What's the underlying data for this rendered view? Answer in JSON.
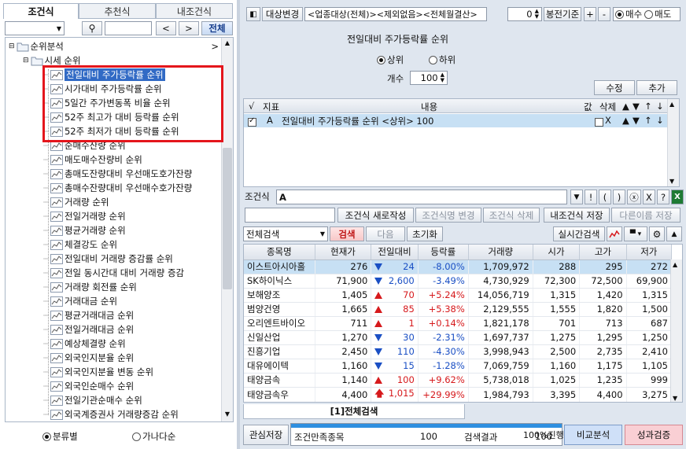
{
  "left": {
    "tabs": [
      "조건식",
      "추천식",
      "내조건식"
    ],
    "search_button": "전체",
    "tree": {
      "root": "순위분석",
      "group": "시세 순위",
      "items": [
        "전일대비 주가등락률 순위",
        "시가대비 주가등락률  순위",
        "5일간 주가변동폭 비율 순위",
        "52주 최고가 대비 등락률 순위",
        "52주 최저가 대비 등락률 순위",
        "순매수잔량 순위",
        "매도매수잔량비 순위",
        "총매도잔량대비 우선매도호가잔량",
        "총매수잔량대비 우선매수호가잔량",
        "거래량 순위",
        "전일거래량 순위",
        "평균거래량 순위",
        "체결강도 순위",
        "전일대비 거래량 증감률 순위",
        "전일 동시간대 대비 거래량 증감",
        "거래량 회전률 순위",
        "거래대금 순위",
        "평균거래대금 순위",
        "전일거래대금 순위",
        "예상체결량 순위",
        "외국인지분율 순위",
        "외국인지분율 변동 순위",
        "외국인순매수 순위",
        "전일기관순매수 순위",
        "외국계증권사 거래량증감 순위"
      ]
    },
    "radio": [
      "분류별",
      "가나다순"
    ]
  },
  "top": {
    "target_button": "대상변경",
    "target_text": "<업종대상(전체)><제외없음><전체월결산>",
    "count": "0",
    "candle_button": "봉전기준",
    "plus": "+",
    "minus": "-",
    "buy": "매수",
    "sell": "매도",
    "condition_title": "전일대비 주가등락률 순위",
    "rank_top": "상위",
    "rank_bottom": "하위",
    "count_label": "개수",
    "count_value": "100",
    "edit_button": "수정",
    "add_button": "추가"
  },
  "cond_table": {
    "headers": [
      "√",
      "지표",
      "내용",
      "값",
      "삭제",
      "▲",
      "▼",
      "↑",
      "↓"
    ],
    "row": {
      "code": "A",
      "content": "전일대비 주가등락률 순위 <상위> 100",
      "del": "X",
      "up": "▲",
      "down": "▼",
      "top": "↑",
      "bottom": "↓"
    }
  },
  "formula": {
    "label": "조건식",
    "value": "A",
    "ops": [
      "▼",
      "!",
      "(",
      ")",
      "ⓧ",
      "X",
      "?"
    ]
  },
  "actions": {
    "new": "조건식 새로작성",
    "rename": "조건식명 변경",
    "delete": "조건식 삭제",
    "save_mine": "내조건식 저장",
    "save_as": "다른이름 저장"
  },
  "search": {
    "combo": "전체검색",
    "search": "검색",
    "next": "다음",
    "reset": "초기화",
    "realtime": "실시간검색"
  },
  "results": {
    "headers": [
      "종목명",
      "현재가",
      "전일대비",
      "등락률",
      "거래량",
      "시가",
      "고가",
      "저가"
    ],
    "rows": [
      {
        "name": "이스트아시아홀",
        "price": "276",
        "dir": "dn",
        "chg": "24",
        "rate": "-8.00%",
        "vol": "1,709,972",
        "open": "288",
        "high": "295",
        "low": "272"
      },
      {
        "name": "SK하이닉스",
        "price": "71,900",
        "dir": "dn",
        "chg": "2,600",
        "rate": "-3.49%",
        "vol": "4,730,929",
        "open": "72,300",
        "high": "72,500",
        "low": "69,900"
      },
      {
        "name": "보해양조",
        "price": "1,405",
        "dir": "up",
        "chg": "70",
        "rate": "+5.24%",
        "vol": "14,056,719",
        "open": "1,315",
        "high": "1,420",
        "low": "1,315"
      },
      {
        "name": "범양건영",
        "price": "1,665",
        "dir": "up",
        "chg": "85",
        "rate": "+5.38%",
        "vol": "2,129,555",
        "open": "1,555",
        "high": "1,820",
        "low": "1,500"
      },
      {
        "name": "오리엔트바이오",
        "price": "711",
        "dir": "up",
        "chg": "1",
        "rate": "+0.14%",
        "vol": "1,821,178",
        "open": "701",
        "high": "713",
        "low": "687"
      },
      {
        "name": "신일산업",
        "price": "1,270",
        "dir": "dn",
        "chg": "30",
        "rate": "-2.31%",
        "vol": "1,697,737",
        "open": "1,275",
        "high": "1,295",
        "low": "1,250"
      },
      {
        "name": "진흥기업",
        "price": "2,450",
        "dir": "dn",
        "chg": "110",
        "rate": "-4.30%",
        "vol": "3,998,943",
        "open": "2,500",
        "high": "2,735",
        "low": "2,410"
      },
      {
        "name": "대유에이텍",
        "price": "1,160",
        "dir": "dn",
        "chg": "15",
        "rate": "-1.28%",
        "vol": "7,069,759",
        "open": "1,160",
        "high": "1,175",
        "low": "1,105"
      },
      {
        "name": "태양금속",
        "price": "1,140",
        "dir": "up",
        "chg": "100",
        "rate": "+9.62%",
        "vol": "5,738,018",
        "open": "1,025",
        "high": "1,235",
        "low": "999"
      },
      {
        "name": "태양금속우",
        "price": "4,400",
        "dir": "limit",
        "chg": "1,015",
        "rate": "+29.99%",
        "vol": "1,984,793",
        "open": "3,395",
        "high": "4,400",
        "low": "3,275"
      }
    ]
  },
  "result_tab": "[1]전체검색",
  "bottom": {
    "save": "관심저장",
    "match_label": "조건만족종목",
    "match_value": "100",
    "result_label": "검색결과",
    "result_value": "100",
    "progress": "100%진행",
    "progress_fraction": 1.0,
    "compare": "비교분석",
    "verify": "성과검증"
  },
  "colors": {
    "selected_row": "#c7e0f4",
    "highlight_red": "#e4161c",
    "verify_bg": "#f9cfd4",
    "compare_bg": "#cfe0f8"
  }
}
